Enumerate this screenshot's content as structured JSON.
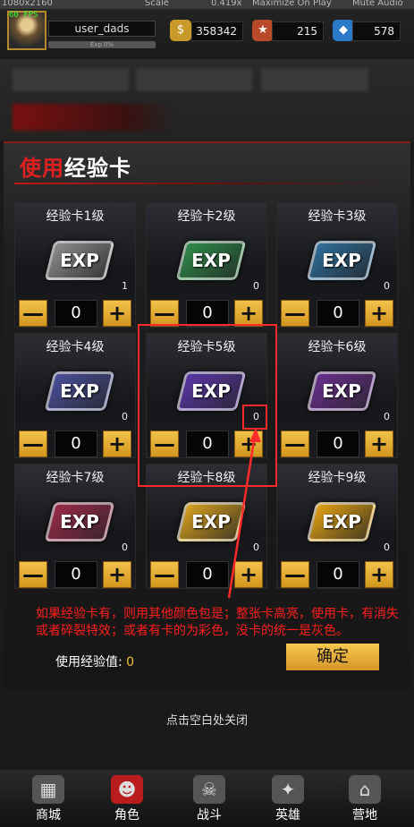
{
  "editor_bar": {
    "resolution": "1080x2160",
    "scale": "Scale",
    "scale_value": "0.419x",
    "maximize": "Maximize On Play",
    "mute": "Mute Audio"
  },
  "header": {
    "fps": "60 FPS",
    "username": "user_dads",
    "exp_text": "Exp 0%",
    "currencies": [
      {
        "icon": "gold-coin-icon",
        "value": "358342"
      },
      {
        "icon": "badge-icon",
        "value": "215"
      },
      {
        "icon": "diamond-icon",
        "value": "578"
      }
    ]
  },
  "panel": {
    "title_red": "使用",
    "title_white": "经验卡",
    "cards": [
      {
        "name": "经验卡1级",
        "count": "1",
        "qty": "0",
        "color": "#8c8c8c"
      },
      {
        "name": "经验卡2级",
        "count": "0",
        "qty": "0",
        "color": "#2f8a4a"
      },
      {
        "name": "经验卡3级",
        "count": "0",
        "qty": "0",
        "color": "#2f6d9a"
      },
      {
        "name": "经验卡4级",
        "count": "0",
        "qty": "0",
        "color": "#4a4f9a"
      },
      {
        "name": "经验卡5级",
        "count": "0",
        "qty": "0",
        "color": "#5a36a6"
      },
      {
        "name": "经验卡6级",
        "count": "0",
        "qty": "0",
        "color": "#6a2f8e"
      },
      {
        "name": "经验卡7级",
        "count": "0",
        "qty": "0",
        "color": "#9a2a4a"
      },
      {
        "name": "经验卡8级",
        "count": "0",
        "qty": "0",
        "color": "#d6a020"
      },
      {
        "name": "经验卡9级",
        "count": "0",
        "qty": "0",
        "color": "#e0a014"
      }
    ],
    "exp_label": "EXP",
    "minus": "—",
    "plus": "+",
    "annotation": "如果经验卡有，则用其他颜色包是；整张卡高亮，使用卡，有消失或者碎裂特效；或者有卡的为彩色，没卡的统一是灰色。",
    "use_value_label": "使用经验值:",
    "use_value": "0",
    "confirm": "确定"
  },
  "close_hint": "点击空白处关闭",
  "nav": [
    {
      "label": "商城",
      "icon": "shop-icon"
    },
    {
      "label": "角色",
      "icon": "character-icon"
    },
    {
      "label": "战斗",
      "icon": "battle-icon"
    },
    {
      "label": "英雄",
      "icon": "hero-icon"
    },
    {
      "label": "营地",
      "icon": "camp-icon"
    }
  ],
  "colors": {
    "accent_red": "#e02020",
    "annotation_red": "#ff1e1e",
    "button_gold": "#f0c030"
  }
}
